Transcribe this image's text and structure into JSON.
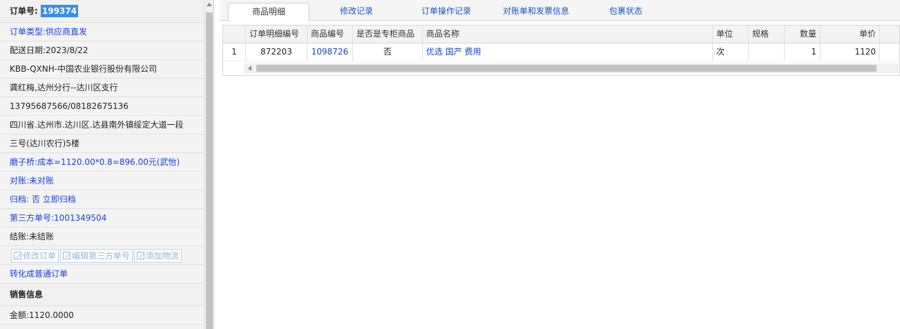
{
  "left": {
    "order_label": "订单号:",
    "order_no": "199374",
    "order_type": "订单类型:供应商直发",
    "delivery_date": "配送日期:2023/8/22",
    "customer": "KBB-QXNH-中国农业银行股份有限公司",
    "contact": "龚红梅,达州分行--达川区支行",
    "phones": "13795687566/08182675136",
    "address_line1": "四川省.达州市.达川区.达县南外镇绥定大道一段",
    "address_line2": "三号(达川农行)5楼",
    "cost_note": "磨子桥:成本=1120.00*0.8=896.00元(武怡)",
    "reconcile": "对账:未对账",
    "archive_label": "归档:",
    "archive_value": "否",
    "archive_action": "立即归档",
    "third_party": "第三方单号:1001349504",
    "settle": "结账:未结账",
    "buttons": {
      "edit_order": "修改订单",
      "edit_third": "编辑第三方单号",
      "add_logistics": "添加物流"
    },
    "convert": "转化成普通订单",
    "sales_header": "销售信息",
    "amount": "金额:1120.0000"
  },
  "tabs": [
    {
      "label": "商品明细",
      "active": true
    },
    {
      "label": "修改记录"
    },
    {
      "label": "订单操作记录"
    },
    {
      "label": "对账单和发票信息"
    },
    {
      "label": "包裹状态"
    }
  ],
  "grid": {
    "headers": [
      "订单明细编号",
      "商品编号",
      "是否是专柜商品",
      "商品名称",
      "单位",
      "规格",
      "数量",
      "单价"
    ],
    "row": {
      "index": "1",
      "detail_no": "872203",
      "product_no": "1098726",
      "is_counter": "否",
      "name": "优选 国产 费用",
      "unit": "次",
      "spec": "",
      "qty": "1",
      "price": "1120"
    }
  },
  "colors": {
    "link": "#1a3fd6",
    "selection": "#3a8ee6"
  }
}
